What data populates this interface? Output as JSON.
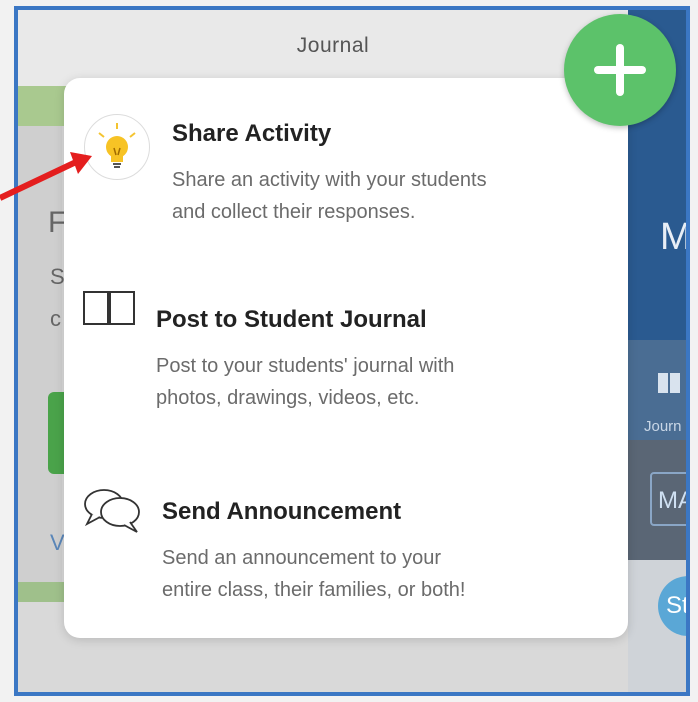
{
  "header": {
    "title": "Journal"
  },
  "background": {
    "left_letters": [
      "F",
      "S",
      "c",
      "V"
    ],
    "right_letter": "M",
    "right_tab_label": "Journ",
    "right_button_label": "MA",
    "right_avatar_label": "St"
  },
  "add_button": {
    "icon": "plus-icon",
    "color": "#5cc26a"
  },
  "menu": {
    "items": [
      {
        "icon": "lightbulb-icon",
        "title": "Share Activity",
        "desc_line1": "Share an activity with your students",
        "desc_line2": "and collect their responses."
      },
      {
        "icon": "book-icon",
        "title": "Post to Student Journal",
        "desc_line1": "Post to your students' journal with",
        "desc_line2": "photos, drawings, videos, etc."
      },
      {
        "icon": "chat-bubbles-icon",
        "title": "Send Announcement",
        "desc_line1": "Send an announcement to your",
        "desc_line2": "entire class, their families, or both!"
      }
    ]
  },
  "annotation": {
    "arrow_color": "#e41e1e"
  },
  "colors": {
    "frame": "#3b77c4",
    "accent_green": "#5cc26a",
    "right_panel": "#2e5f96"
  }
}
